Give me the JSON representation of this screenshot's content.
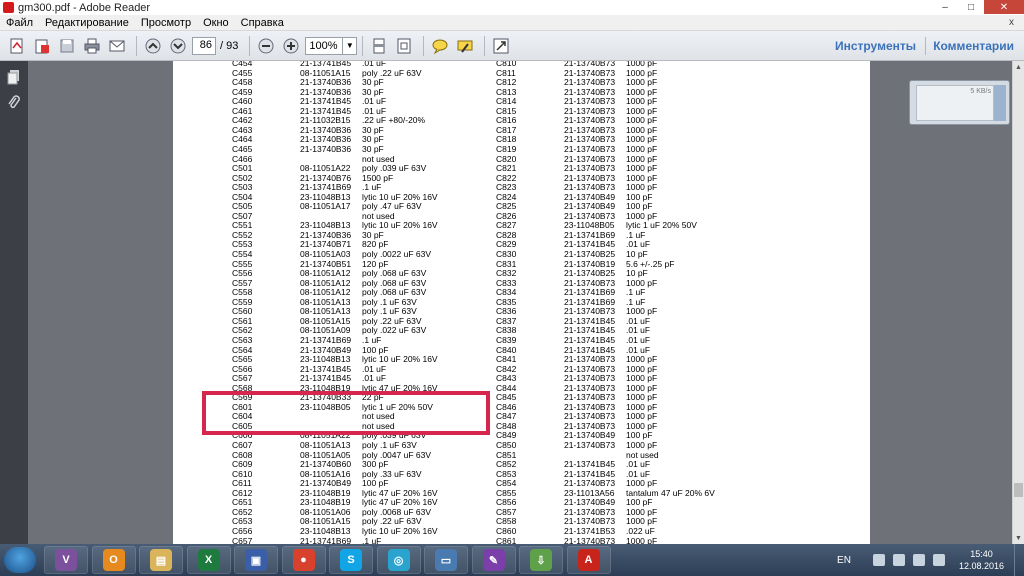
{
  "window": {
    "title": "gm300.pdf - Adobe Reader",
    "min_label": "–",
    "max_label": "□",
    "close_label": "✕"
  },
  "menu": [
    "Файл",
    "Редактирование",
    "Просмотр",
    "Окно",
    "Справка"
  ],
  "menu_close": "x",
  "toolbar": {
    "page_current": "86",
    "page_total": "/ 93",
    "zoom": "100%",
    "tools_label": "Инструменты",
    "comments_label": "Комментарии"
  },
  "download_widget": {
    "speed": "5 KB/s"
  },
  "table_left": [
    [
      "C454",
      "21-13741B45",
      ".01 uF"
    ],
    [
      "C455",
      "08-11051A15",
      "poly .22 uF 63V"
    ],
    [
      "C458",
      "21-13740B36",
      "30 pF"
    ],
    [
      "C459",
      "21-13740B36",
      "30 pF"
    ],
    [
      "C460",
      "21-13741B45",
      ".01 uF"
    ],
    [
      "C461",
      "21-13741B45",
      ".01 uF"
    ],
    [
      "C462",
      "21-11032B15",
      ".22 uF +80/-20%"
    ],
    [
      "C463",
      "21-13740B36",
      "30 pF"
    ],
    [
      "C464",
      "21-13740B36",
      "30 pF"
    ],
    [
      "C465",
      "21-13740B36",
      "30 pF"
    ],
    [
      "C466",
      "",
      "not used"
    ],
    [
      "C501",
      "08-11051A22",
      "poly .039 uF 63V"
    ],
    [
      "C502",
      "21-13740B76",
      "1500 pF"
    ],
    [
      "C503",
      "21-13741B69",
      ".1 uF"
    ],
    [
      "C504",
      "23-11048B13",
      "lytic 10 uF 20% 16V"
    ],
    [
      "C505",
      "08-11051A17",
      "poly .47 uF 63V"
    ],
    [
      "C507",
      "",
      "not used"
    ],
    [
      "C551",
      "23-11048B13",
      "lytic 10 uF 20% 16V"
    ],
    [
      "C552",
      "21-13740B36",
      "30 pF"
    ],
    [
      "C553",
      "21-13740B71",
      "820 pF"
    ],
    [
      "C554",
      "08-11051A03",
      "poly .0022 uF 63V"
    ],
    [
      "C555",
      "21-13740B51",
      "120 pF"
    ],
    [
      "C556",
      "08-11051A12",
      "poly .068 uF 63V"
    ],
    [
      "C557",
      "08-11051A12",
      "poly .068 uF 63V"
    ],
    [
      "C558",
      "08-11051A12",
      "poly .068 uF 63V"
    ],
    [
      "C559",
      "08-11051A13",
      "poly .1 uF 63V"
    ],
    [
      "C560",
      "08-11051A13",
      "poly .1 uF 63V"
    ],
    [
      "C561",
      "08-11051A15",
      "poly .22 uF 63V"
    ],
    [
      "C562",
      "08-11051A09",
      "poly .022 uF 63V"
    ],
    [
      "C563",
      "21-13741B69",
      ".1 uF"
    ],
    [
      "C564",
      "21-13740B49",
      "100 pF"
    ],
    [
      "C565",
      "23-11048B13",
      "lytic 10 uF 20% 16V"
    ],
    [
      "C566",
      "21-13741B45",
      ".01 uF"
    ],
    [
      "C567",
      "21-13741B45",
      ".01 uF"
    ],
    [
      "C568",
      "23-11048B19",
      "lytic 47 uF 20% 16V"
    ],
    [
      "C569",
      "21-13740B33",
      "22 pF"
    ],
    [
      "C601",
      "23-11048B05",
      "lytic 1 uF 20% 50V"
    ],
    [
      "C604",
      "",
      "not used"
    ],
    [
      "C605",
      "",
      "not used"
    ],
    [
      "C606",
      "08-11051A22",
      "poly .039 uF 63V"
    ],
    [
      "C607",
      "08-11051A13",
      "poly .1 uF 63V"
    ],
    [
      "C608",
      "08-11051A05",
      "poly .0047 uF 63V"
    ],
    [
      "C609",
      "21-13740B60",
      "300 pF"
    ],
    [
      "C610",
      "08-11051A16",
      "poly .33 uF 63V"
    ],
    [
      "C611",
      "21-13740B49",
      "100 pF"
    ],
    [
      "C612",
      "23-11048B19",
      "lytic 47 uF 20% 16V"
    ],
    [
      "C651",
      "23-11048B19",
      "lytic 47 uF 20% 16V"
    ],
    [
      "C652",
      "08-11051A06",
      "poly .0068 uF 63V"
    ],
    [
      "C653",
      "08-11051A15",
      "poly .22 uF 63V"
    ],
    [
      "C656",
      "23-11048B13",
      "lytic 10 uF 20% 16V"
    ],
    [
      "C657",
      "21-13741B69",
      ".1 uF"
    ]
  ],
  "table_right": [
    [
      "C810",
      "21-13740B73",
      "1000 pF"
    ],
    [
      "C811",
      "21-13740B73",
      "1000 pF"
    ],
    [
      "C812",
      "21-13740B73",
      "1000 pF"
    ],
    [
      "C813",
      "21-13740B73",
      "1000 pF"
    ],
    [
      "C814",
      "21-13740B73",
      "1000 pF"
    ],
    [
      "C815",
      "21-13740B73",
      "1000 pF"
    ],
    [
      "C816",
      "21-13740B73",
      "1000 pF"
    ],
    [
      "C817",
      "21-13740B73",
      "1000 pF"
    ],
    [
      "C818",
      "21-13740B73",
      "1000 pF"
    ],
    [
      "C819",
      "21-13740B73",
      "1000 pF"
    ],
    [
      "C820",
      "21-13740B73",
      "1000 pF"
    ],
    [
      "C821",
      "21-13740B73",
      "1000 pF"
    ],
    [
      "C822",
      "21-13740B73",
      "1000 pF"
    ],
    [
      "C823",
      "21-13740B73",
      "1000 pF"
    ],
    [
      "C824",
      "21-13740B49",
      "100 pF"
    ],
    [
      "C825",
      "21-13740B49",
      "100 pF"
    ],
    [
      "C826",
      "21-13740B73",
      "1000 pF"
    ],
    [
      "C827",
      "23-11048B05",
      "lytic 1 uF 20% 50V"
    ],
    [
      "C828",
      "21-13741B69",
      ".1 uF"
    ],
    [
      "C829",
      "21-13741B45",
      ".01 uF"
    ],
    [
      "C830",
      "21-13740B25",
      "10 pF"
    ],
    [
      "C831",
      "21-13740B19",
      "5.6 +/-.25 pF"
    ],
    [
      "C832",
      "21-13740B25",
      "10 pF"
    ],
    [
      "C833",
      "21-13740B73",
      "1000 pF"
    ],
    [
      "C834",
      "21-13741B69",
      ".1 uF"
    ],
    [
      "C835",
      "21-13741B69",
      ".1 uF"
    ],
    [
      "C836",
      "21-13740B73",
      "1000 pF"
    ],
    [
      "C837",
      "21-13741B45",
      ".01 uF"
    ],
    [
      "C838",
      "21-13741B45",
      ".01 uF"
    ],
    [
      "C839",
      "21-13741B45",
      ".01 uF"
    ],
    [
      "C840",
      "21-13741B45",
      ".01 uF"
    ],
    [
      "C841",
      "21-13740B73",
      "1000 pF"
    ],
    [
      "C842",
      "21-13740B73",
      "1000 pF"
    ],
    [
      "C843",
      "21-13740B73",
      "1000 pF"
    ],
    [
      "C844",
      "21-13740B73",
      "1000 pF"
    ],
    [
      "C845",
      "21-13740B73",
      "1000 pF"
    ],
    [
      "C846",
      "21-13740B73",
      "1000 pF"
    ],
    [
      "C847",
      "21-13740B73",
      "1000 pF"
    ],
    [
      "C848",
      "21-13740B73",
      "1000 pF"
    ],
    [
      "C849",
      "21-13740B49",
      "100 pF"
    ],
    [
      "C850",
      "21-13740B73",
      "1000 pF"
    ],
    [
      "C851",
      "",
      "not used"
    ],
    [
      "C852",
      "21-13741B45",
      ".01 uF"
    ],
    [
      "C853",
      "21-13741B45",
      ".01 uF"
    ],
    [
      "C854",
      "21-13740B73",
      "1000 pF"
    ],
    [
      "C855",
      "23-11013A56",
      "tantalum 47 uF 20% 6V"
    ],
    [
      "C856",
      "21-13740B49",
      "100 pF"
    ],
    [
      "C857",
      "21-13740B73",
      "1000 pF"
    ],
    [
      "C858",
      "21-13740B73",
      "1000 pF"
    ],
    [
      "C860",
      "21-13741B53",
      ".022 uF"
    ],
    [
      "C861",
      "21-13740B73",
      "1000 pF"
    ]
  ],
  "taskbar": {
    "apps": [
      {
        "name": "viber",
        "glyph": "V",
        "color": "#7b519d"
      },
      {
        "name": "outlook",
        "glyph": "O",
        "color": "#e68a1f"
      },
      {
        "name": "explorer",
        "glyph": "▤",
        "color": "#d9b45a"
      },
      {
        "name": "excel",
        "glyph": "X",
        "color": "#1f7a3f"
      },
      {
        "name": "save-disk",
        "glyph": "▣",
        "color": "#3a5fa8"
      },
      {
        "name": "chrome",
        "glyph": "●",
        "color": "#d9412f"
      },
      {
        "name": "skype",
        "glyph": "S",
        "color": "#12a5e6"
      },
      {
        "name": "camera",
        "glyph": "◎",
        "color": "#2aa3cf"
      },
      {
        "name": "monitor",
        "glyph": "▭",
        "color": "#4a7bb0"
      },
      {
        "name": "notepad",
        "glyph": "✎",
        "color": "#7a3fa8"
      },
      {
        "name": "download-manager",
        "glyph": "⇩",
        "color": "#5fa04a"
      },
      {
        "name": "adobe-reader",
        "glyph": "A",
        "color": "#c9241c"
      }
    ],
    "lang": "EN",
    "time": "15:40",
    "date": "12.08.2016"
  }
}
